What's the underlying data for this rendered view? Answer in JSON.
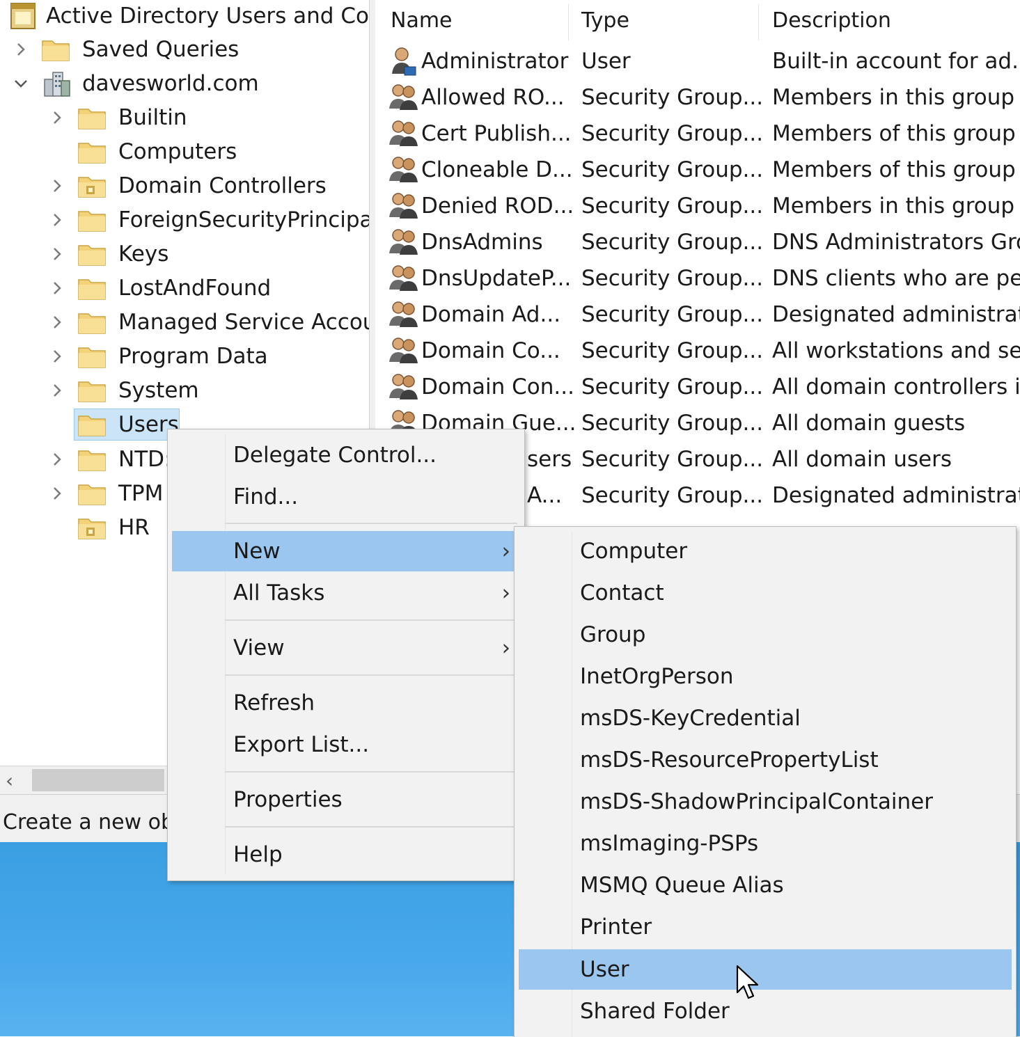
{
  "tree": {
    "items": [
      {
        "label": "Active Directory Users and Com",
        "icon": "snapin-icon",
        "chevron": ""
      },
      {
        "label": "Saved Queries",
        "icon": "folder-icon",
        "chevron": "collapsed"
      },
      {
        "label": "davesworld.com",
        "icon": "domain-icon",
        "chevron": "expanded"
      },
      {
        "label": "Builtin",
        "icon": "folder-icon",
        "chevron": "collapsed"
      },
      {
        "label": "Computers",
        "icon": "folder-icon",
        "chevron": ""
      },
      {
        "label": "Domain Controllers",
        "icon": "ou-folder-icon",
        "chevron": "collapsed"
      },
      {
        "label": "ForeignSecurityPrincipal:",
        "icon": "folder-icon",
        "chevron": "collapsed"
      },
      {
        "label": "Keys",
        "icon": "folder-icon",
        "chevron": "collapsed"
      },
      {
        "label": "LostAndFound",
        "icon": "folder-icon",
        "chevron": "collapsed"
      },
      {
        "label": "Managed Service Accour",
        "icon": "folder-icon",
        "chevron": "collapsed"
      },
      {
        "label": "Program Data",
        "icon": "folder-icon",
        "chevron": "collapsed"
      },
      {
        "label": "System",
        "icon": "folder-icon",
        "chevron": "collapsed"
      },
      {
        "label": "Users",
        "icon": "folder-icon",
        "chevron": "",
        "selected": true
      },
      {
        "label": "NTD:",
        "icon": "folder-icon",
        "chevron": "collapsed"
      },
      {
        "label": "TPM",
        "icon": "folder-icon",
        "chevron": "collapsed"
      },
      {
        "label": "HR",
        "icon": "ou-folder-icon",
        "chevron": ""
      }
    ]
  },
  "list": {
    "columns": [
      "Name",
      "Type",
      "Description"
    ],
    "rows": [
      {
        "name": "Administrator",
        "type": "User",
        "description": "Built-in account for ad...",
        "icon": "user-icon"
      },
      {
        "name": "Allowed RO...",
        "type": "Security Group...",
        "description": "Members in this group c.",
        "icon": "group-icon"
      },
      {
        "name": "Cert Publish...",
        "type": "Security Group...",
        "description": "Members of this group ..",
        "icon": "group-icon"
      },
      {
        "name": "Cloneable D...",
        "type": "Security Group...",
        "description": "Members of this group t.",
        "icon": "group-icon"
      },
      {
        "name": "Denied ROD...",
        "type": "Security Group...",
        "description": "Members in this group c.",
        "icon": "group-icon"
      },
      {
        "name": "DnsAdmins",
        "type": "Security Group...",
        "description": "DNS Administrators Gro..",
        "icon": "group-icon"
      },
      {
        "name": "DnsUpdateP...",
        "type": "Security Group...",
        "description": "DNS clients who are per..",
        "icon": "group-icon"
      },
      {
        "name": "Domain Ad...",
        "type": "Security Group...",
        "description": "Designated administrato.",
        "icon": "group-icon"
      },
      {
        "name": "Domain Co...",
        "type": "Security Group...",
        "description": "All workstations and ser...",
        "icon": "group-icon"
      },
      {
        "name": "Domain Con...",
        "type": "Security Group...",
        "description": "All domain controllers i...",
        "icon": "group-icon"
      },
      {
        "name": "Domain Gue...",
        "type": "Security Group...",
        "description": "All domain guests",
        "icon": "group-icon"
      },
      {
        "name": "sers",
        "type": "Security Group...",
        "description": "All domain users",
        "icon": ""
      },
      {
        "name": "A...",
        "type": "Security Group...",
        "description": "Designated administrato.",
        "icon": ""
      }
    ]
  },
  "status": {
    "text": "Create a new obj"
  },
  "context_menu": {
    "items": [
      {
        "label": "Delegate Control...",
        "submenu": false
      },
      {
        "label": "Find...",
        "submenu": false
      },
      {
        "label": "New",
        "submenu": true,
        "highlighted": true
      },
      {
        "label": "All Tasks",
        "submenu": true
      },
      {
        "label": "View",
        "submenu": true
      },
      {
        "label": "Refresh",
        "submenu": false
      },
      {
        "label": "Export List...",
        "submenu": false
      },
      {
        "label": "Properties",
        "submenu": false
      },
      {
        "label": "Help",
        "submenu": false
      }
    ],
    "submenu_arrow": "›"
  },
  "new_submenu": {
    "items": [
      {
        "label": "Computer"
      },
      {
        "label": "Contact"
      },
      {
        "label": "Group"
      },
      {
        "label": "InetOrgPerson"
      },
      {
        "label": "msDS-KeyCredential"
      },
      {
        "label": "msDS-ResourcePropertyList"
      },
      {
        "label": "msDS-ShadowPrincipalContainer"
      },
      {
        "label": "msImaging-PSPs"
      },
      {
        "label": "MSMQ Queue Alias"
      },
      {
        "label": "Printer"
      },
      {
        "label": "User",
        "highlighted": true
      },
      {
        "label": "Shared Folder"
      }
    ]
  },
  "colors": {
    "selection": "#cce4f7",
    "menu_highlight": "#9bc6f0",
    "menu_bg": "#f2f2f2",
    "desktop": "#48a8ec",
    "folder": "#f3d27a"
  },
  "scrollbar": {
    "left_arrow": "‹"
  }
}
